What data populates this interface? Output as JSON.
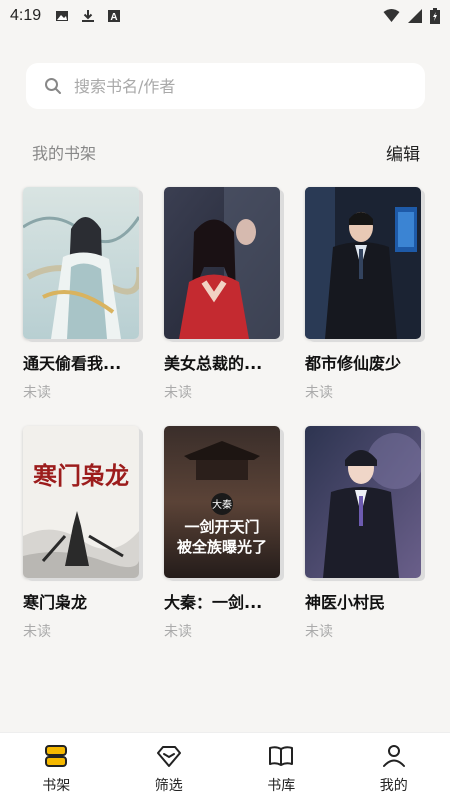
{
  "status_bar": {
    "time": "4:19",
    "left_icons": [
      "image-icon",
      "download-icon",
      "a-icon"
    ],
    "right_icons": [
      "wifi-icon",
      "signal-icon",
      "battery-icon"
    ]
  },
  "search": {
    "placeholder": "搜索书名/作者",
    "value": ""
  },
  "shelf": {
    "title": "我的书架",
    "edit_label": "编辑",
    "books": [
      {
        "title": "通天偷看我...",
        "status": "未读"
      },
      {
        "title": "美女总裁的...",
        "status": "未读"
      },
      {
        "title": "都市修仙废少",
        "status": "未读"
      },
      {
        "title": "寒门枭龙",
        "status": "未读"
      },
      {
        "title": "大秦：一剑...",
        "status": "未读"
      },
      {
        "title": "神医小村民",
        "status": "未读"
      }
    ],
    "cover_texts": {
      "book4_title": "寒门枭龙",
      "book5_badge": "大秦",
      "book5_line1": "一剑开天门",
      "book5_line2": "被全族曝光了"
    }
  },
  "tabbar": {
    "tabs": [
      {
        "label": "书架",
        "icon": "bookshelf-icon",
        "active": true
      },
      {
        "label": "筛选",
        "icon": "diamond-filter-icon",
        "active": false
      },
      {
        "label": "书库",
        "icon": "open-book-icon",
        "active": false
      },
      {
        "label": "我的",
        "icon": "person-icon",
        "active": false
      }
    ]
  },
  "colors": {
    "background": "#f6f5f3",
    "accent": "#f5b800",
    "text_primary": "#111111",
    "text_muted": "#aaaaaa"
  }
}
